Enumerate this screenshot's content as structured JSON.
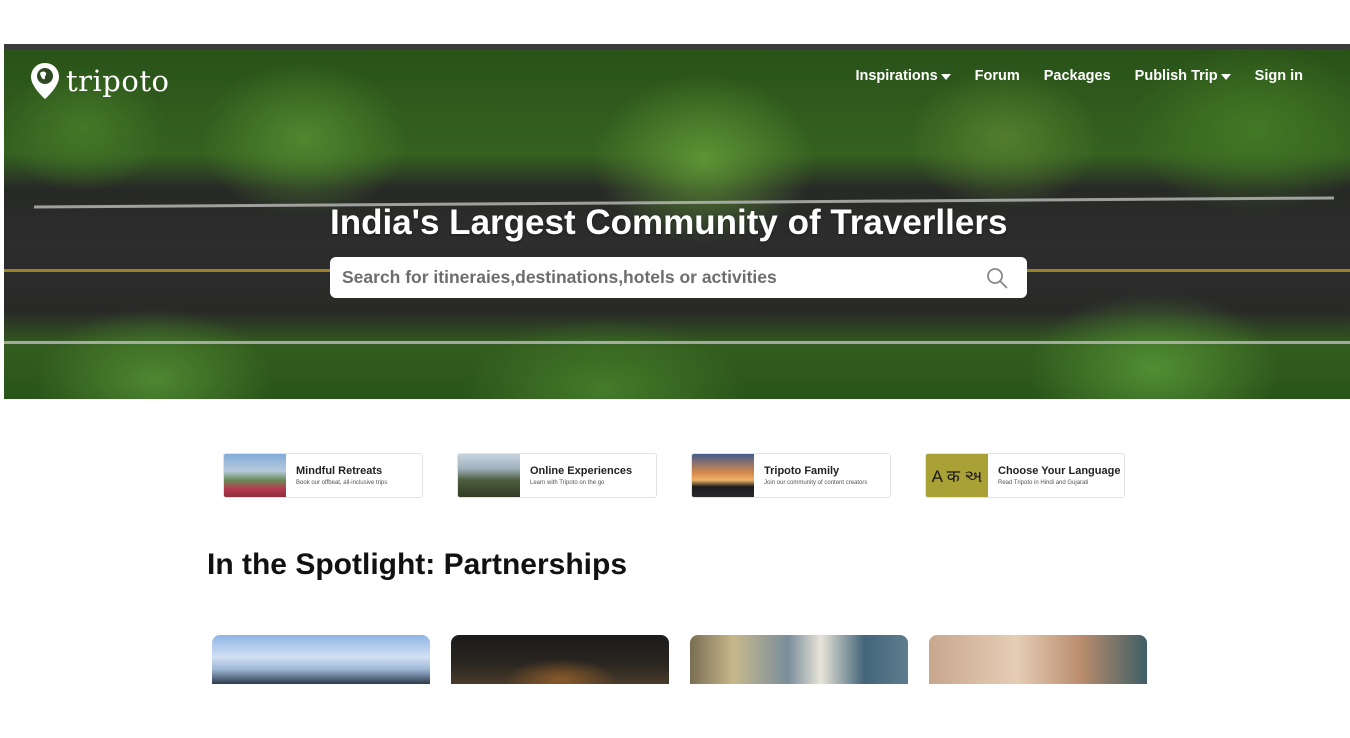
{
  "header": {
    "logo_text": "tripoto",
    "nav": [
      {
        "label": "Inspirations",
        "has_dropdown": true
      },
      {
        "label": "Forum",
        "has_dropdown": false
      },
      {
        "label": "Packages",
        "has_dropdown": false
      },
      {
        "label": "Publish Trip",
        "has_dropdown": true
      },
      {
        "label": "Sign in",
        "has_dropdown": false
      }
    ]
  },
  "hero": {
    "title": "India's Largest Community of Traverllers",
    "search_placeholder": "Search for itineraies,destinations,hotels or activities",
    "search_icon": "search-icon"
  },
  "quick_links": [
    {
      "title": "Mindful Retreats",
      "subtitle": "Book our offbeat, all-inclusive trips"
    },
    {
      "title": "Online Experiences",
      "subtitle": "Learn with Tripoto on the go"
    },
    {
      "title": "Tripoto Family",
      "subtitle": "Join our community of content creators"
    },
    {
      "title": "Choose Your Language",
      "subtitle": "Read Tripoto in Hindi and Gujarati",
      "thumb_text": "A क અ"
    }
  ],
  "spotlight": {
    "title": "In the Spotlight: Partnerships"
  }
}
